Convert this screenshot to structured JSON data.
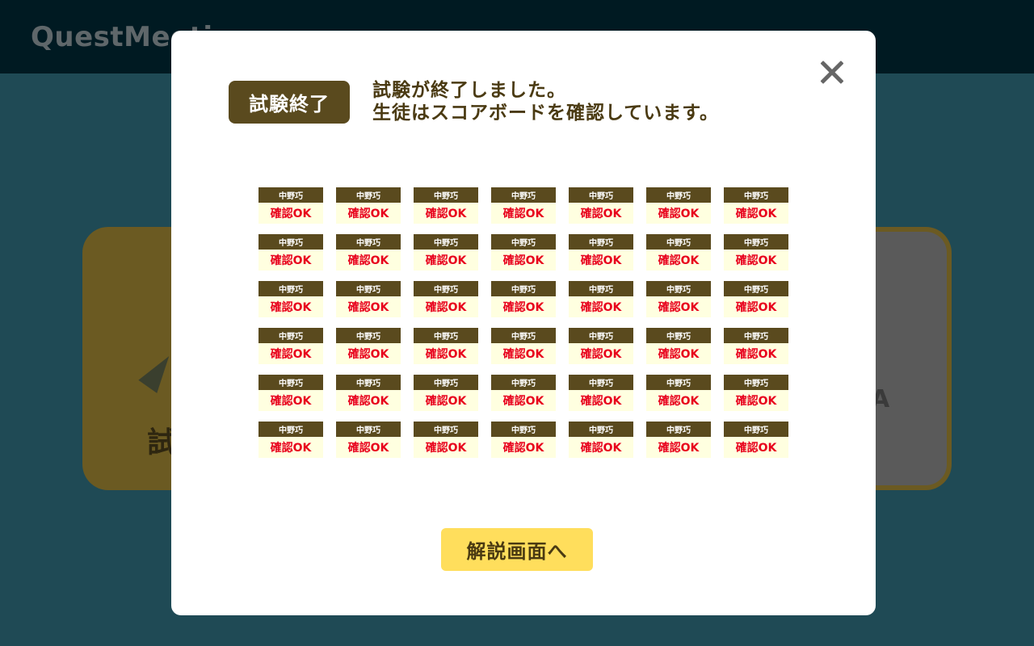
{
  "app": {
    "logo_text": "QuestMeeti"
  },
  "background": {
    "card_text": "試",
    "card_mark": "A"
  },
  "modal": {
    "status_badge": "試験終了",
    "message_line1": "試験が終了しました。",
    "message_line2": "生徒はスコアボードを確認しています。",
    "close_icon": "close-icon",
    "students": [
      {
        "name": "中野巧",
        "status": "確認OK"
      },
      {
        "name": "中野巧",
        "status": "確認OK"
      },
      {
        "name": "中野巧",
        "status": "確認OK"
      },
      {
        "name": "中野巧",
        "status": "確認OK"
      },
      {
        "name": "中野巧",
        "status": "確認OK"
      },
      {
        "name": "中野巧",
        "status": "確認OK"
      },
      {
        "name": "中野巧",
        "status": "確認OK"
      },
      {
        "name": "中野巧",
        "status": "確認OK"
      },
      {
        "name": "中野巧",
        "status": "確認OK"
      },
      {
        "name": "中野巧",
        "status": "確認OK"
      },
      {
        "name": "中野巧",
        "status": "確認OK"
      },
      {
        "name": "中野巧",
        "status": "確認OK"
      },
      {
        "name": "中野巧",
        "status": "確認OK"
      },
      {
        "name": "中野巧",
        "status": "確認OK"
      },
      {
        "name": "中野巧",
        "status": "確認OK"
      },
      {
        "name": "中野巧",
        "status": "確認OK"
      },
      {
        "name": "中野巧",
        "status": "確認OK"
      },
      {
        "name": "中野巧",
        "status": "確認OK"
      },
      {
        "name": "中野巧",
        "status": "確認OK"
      },
      {
        "name": "中野巧",
        "status": "確認OK"
      },
      {
        "name": "中野巧",
        "status": "確認OK"
      },
      {
        "name": "中野巧",
        "status": "確認OK"
      },
      {
        "name": "中野巧",
        "status": "確認OK"
      },
      {
        "name": "中野巧",
        "status": "確認OK"
      },
      {
        "name": "中野巧",
        "status": "確認OK"
      },
      {
        "name": "中野巧",
        "status": "確認OK"
      },
      {
        "name": "中野巧",
        "status": "確認OK"
      },
      {
        "name": "中野巧",
        "status": "確認OK"
      },
      {
        "name": "中野巧",
        "status": "確認OK"
      },
      {
        "name": "中野巧",
        "status": "確認OK"
      },
      {
        "name": "中野巧",
        "status": "確認OK"
      },
      {
        "name": "中野巧",
        "status": "確認OK"
      },
      {
        "name": "中野巧",
        "status": "確認OK"
      },
      {
        "name": "中野巧",
        "status": "確認OK"
      },
      {
        "name": "中野巧",
        "status": "確認OK"
      },
      {
        "name": "中野巧",
        "status": "確認OK"
      },
      {
        "name": "中野巧",
        "status": "確認OK"
      },
      {
        "name": "中野巧",
        "status": "確認OK"
      },
      {
        "name": "中野巧",
        "status": "確認OK"
      },
      {
        "name": "中野巧",
        "status": "確認OK"
      },
      {
        "name": "中野巧",
        "status": "確認OK"
      },
      {
        "name": "中野巧",
        "status": "確認OK"
      }
    ],
    "explain_button": "解説画面へ"
  },
  "colors": {
    "header_bg": "#001a22",
    "page_bg": "#1f4a55",
    "badge_bg": "#5a4a1e",
    "text_brown": "#4a3a12",
    "ok_red": "#e8001c",
    "tile_bg": "#ffffe0",
    "button_yellow": "#ffde5c"
  }
}
